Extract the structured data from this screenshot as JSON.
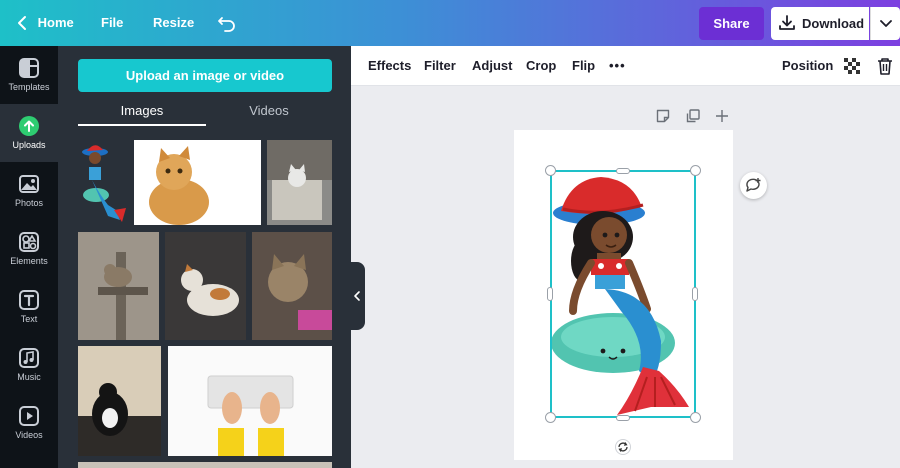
{
  "topbar": {
    "home_label": "Home",
    "file_label": "File",
    "resize_label": "Resize",
    "share_label": "Share",
    "download_label": "Download"
  },
  "rail": {
    "items": [
      {
        "label": "Templates",
        "icon": "templates-icon"
      },
      {
        "label": "Uploads",
        "icon": "upload-cloud-icon"
      },
      {
        "label": "Photos",
        "icon": "photo-icon"
      },
      {
        "label": "Elements",
        "icon": "shapes-icon"
      },
      {
        "label": "Text",
        "icon": "text-icon"
      },
      {
        "label": "Music",
        "icon": "music-note-icon"
      },
      {
        "label": "Videos",
        "icon": "play-icon"
      }
    ]
  },
  "panel": {
    "upload_label": "Upload an image or video",
    "tabs": [
      {
        "label": "Images",
        "active": true
      },
      {
        "label": "Videos",
        "active": false
      }
    ]
  },
  "toolbar": {
    "effects": "Effects",
    "filter": "Filter",
    "adjust": "Adjust",
    "crop": "Crop",
    "flip": "Flip",
    "more": "•••",
    "position": "Position"
  },
  "colors": {
    "accent": "#1ec0c8",
    "share": "#6c2fd4",
    "panel_bg": "#293039",
    "rail_bg": "#0e1318"
  }
}
